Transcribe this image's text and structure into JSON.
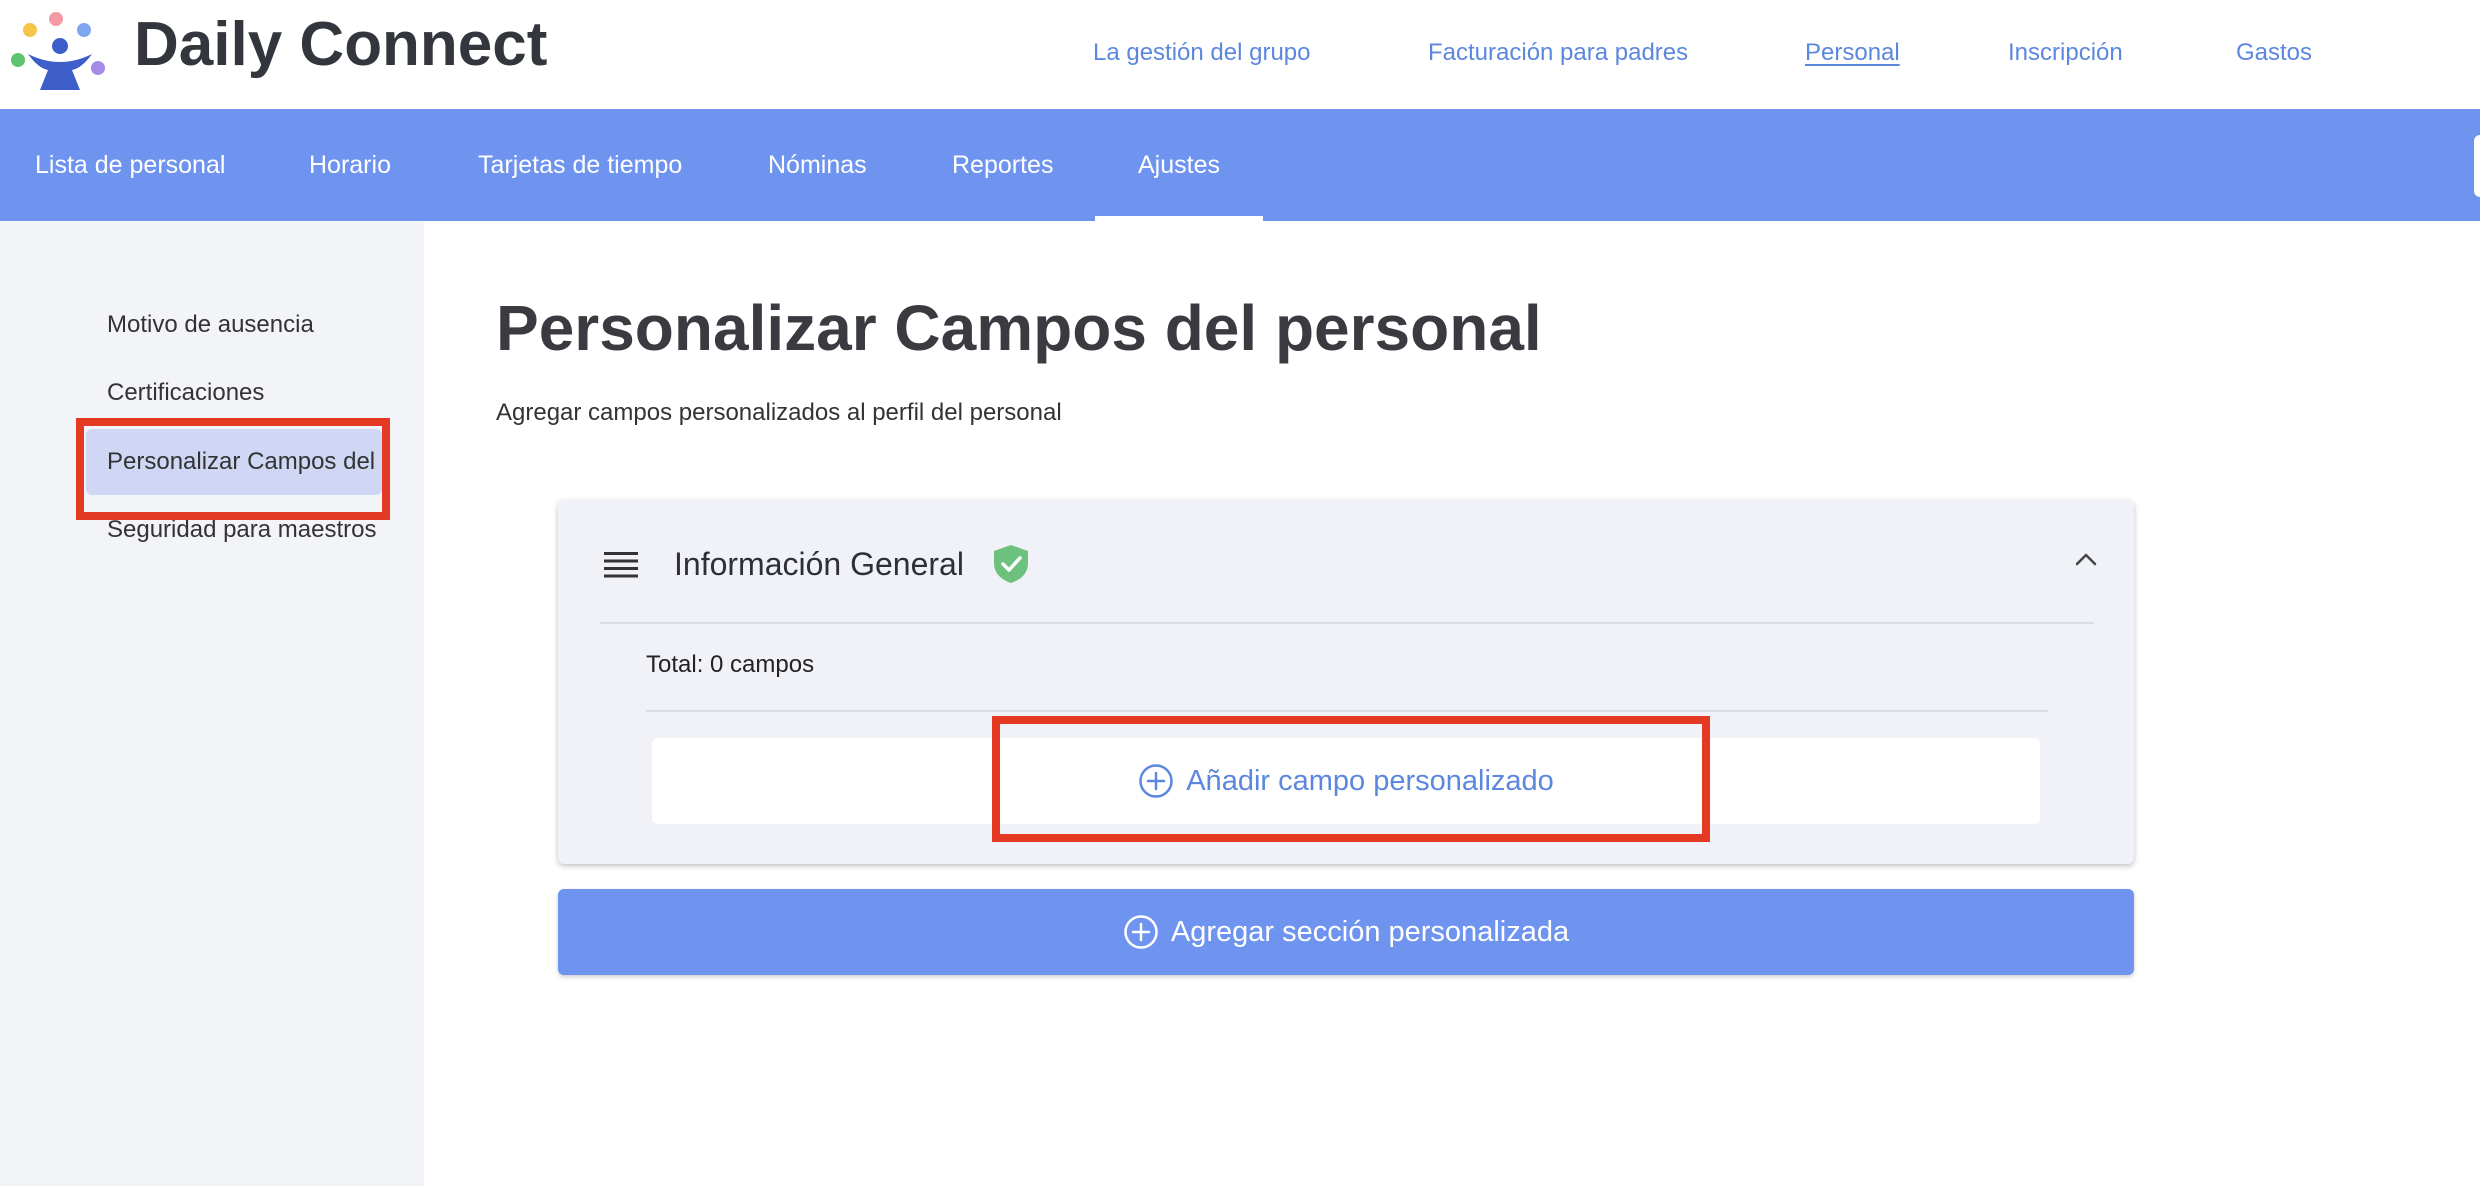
{
  "brand": {
    "name": "Daily Connect",
    "logo_icon": "daily-connect-logo-icon"
  },
  "top_nav": [
    {
      "label": "La gestión del grupo",
      "active": false
    },
    {
      "label": "Facturación para padres",
      "active": false
    },
    {
      "label": "Personal",
      "active": true
    },
    {
      "label": "Inscripción",
      "active": false
    },
    {
      "label": "Gastos",
      "active": false
    }
  ],
  "sub_nav": [
    {
      "label": "Lista de personal"
    },
    {
      "label": "Horario"
    },
    {
      "label": "Tarjetas de tiempo"
    },
    {
      "label": "Nóminas"
    },
    {
      "label": "Reportes"
    },
    {
      "label": "Ajustes",
      "active": true
    }
  ],
  "sidebar": {
    "items": [
      {
        "label": "Motivo de ausencia"
      },
      {
        "label": "Certificaciones"
      },
      {
        "label": "Personalizar Campos del personal",
        "active": true
      },
      {
        "label": "Seguridad para maestros"
      }
    ]
  },
  "main": {
    "title": "Personalizar Campos del personal",
    "subtitle": "Agregar campos personalizados al perfil del personal",
    "section": {
      "title": "Información General",
      "status_icon": "shield-check-icon",
      "total": "Total: 0 campos",
      "add_field_label": "Añadir campo personalizado"
    },
    "add_section_label": "Agregar sección personalizada"
  },
  "colors": {
    "accent": "#6f94ef",
    "link": "#5c87df",
    "highlight": "#e43a23",
    "shield": "#6cc27c"
  }
}
